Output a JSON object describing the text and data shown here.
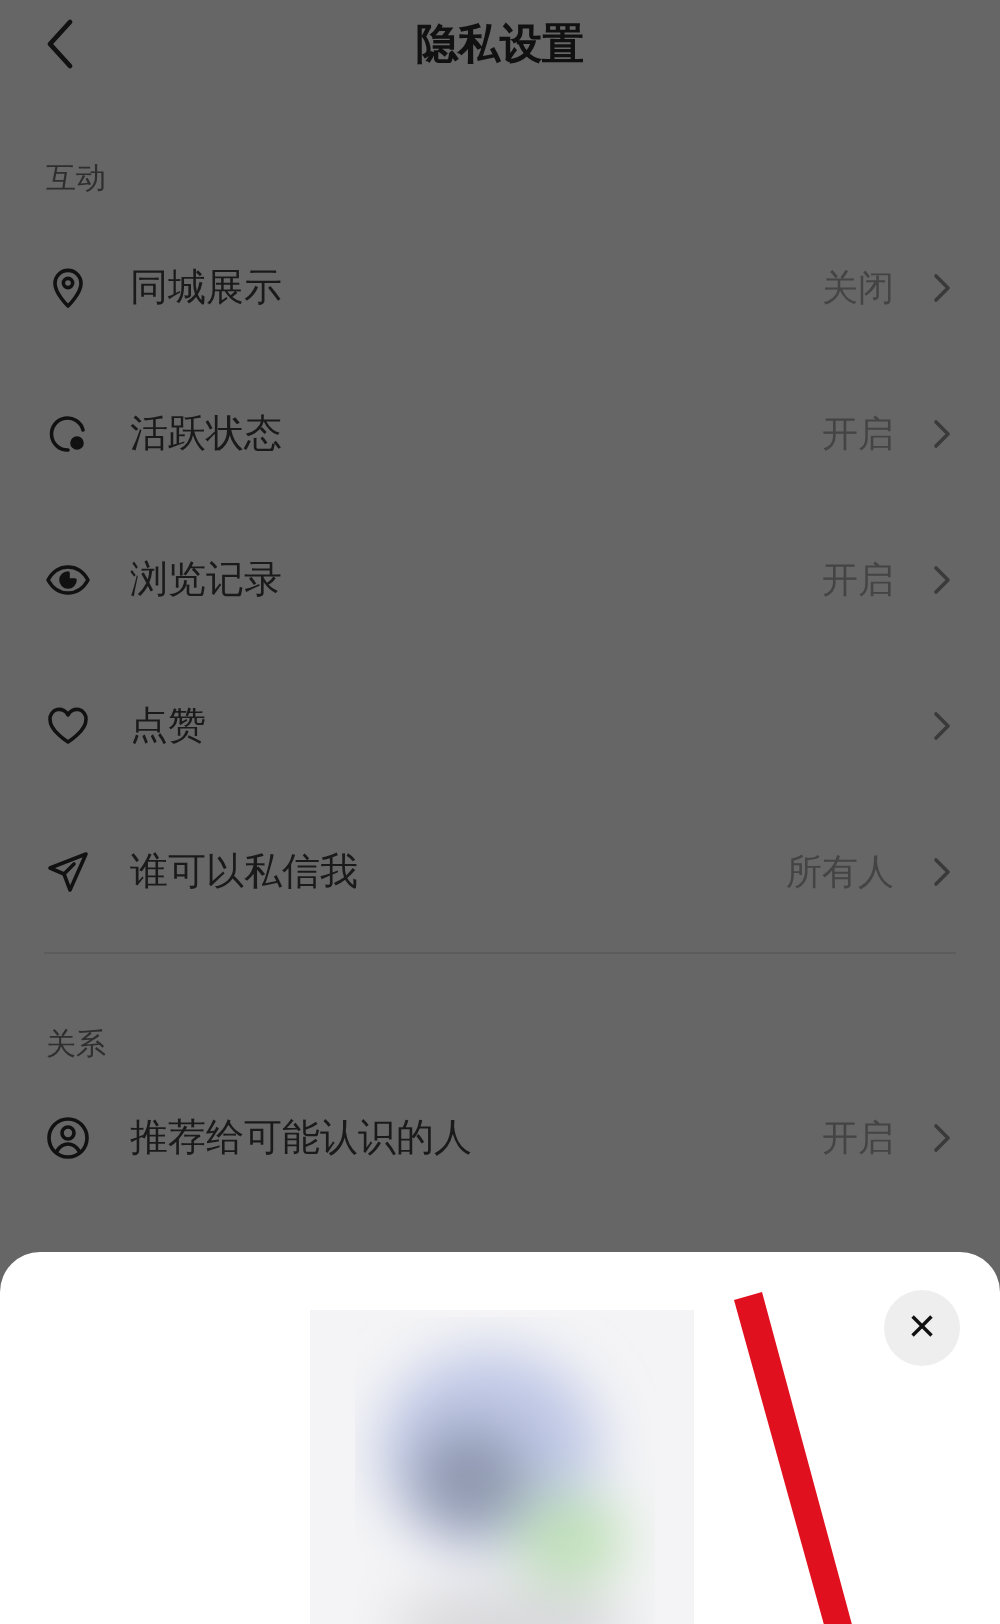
{
  "header": {
    "title": "隐私设置"
  },
  "sections": [
    {
      "title": "互动",
      "items": [
        {
          "label": "同城展示",
          "value": "关闭"
        },
        {
          "label": "活跃状态",
          "value": "开启"
        },
        {
          "label": "浏览记录",
          "value": "开启"
        },
        {
          "label": "点赞"
        },
        {
          "label": "谁可以私信我",
          "value": "所有人"
        }
      ]
    },
    {
      "title": "关系",
      "items": [
        {
          "label": "推荐给可能认识的人",
          "value": "开启"
        }
      ]
    }
  ],
  "sheet": {
    "close": "×"
  }
}
